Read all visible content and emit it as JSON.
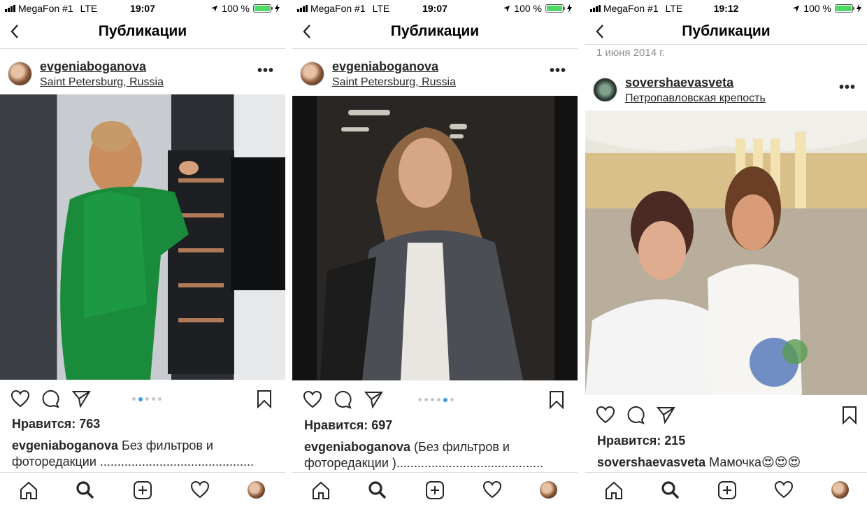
{
  "screens": [
    {
      "status": {
        "carrier": "MegaFon #1",
        "network": "LTE",
        "time": "19:07",
        "battery": "100 %"
      },
      "nav_title": "Публикации",
      "date_header": "",
      "post": {
        "username": "evgeniaboganova",
        "location": "Saint Petersburg, Russia",
        "likes": "Нравится: 763",
        "caption_user": "evgeniaboganova",
        "caption_text": " Без фильтров и фоторедакции ............................................",
        "carousel_active": 1,
        "carousel_count": 5
      }
    },
    {
      "status": {
        "carrier": "MegaFon #1",
        "network": "LTE",
        "time": "19:07",
        "battery": "100 %"
      },
      "nav_title": "Публикации",
      "date_header": "",
      "post": {
        "username": "evgeniaboganova",
        "location": "Saint Petersburg, Russia",
        "likes": "Нравится: 697",
        "caption_user": "evgeniaboganova",
        "caption_text": " (Без фильтров и фоторедакции )..........................................",
        "carousel_active": 4,
        "carousel_count": 6
      }
    },
    {
      "status": {
        "carrier": "MegaFon #1",
        "network": "LTE",
        "time": "19:12",
        "battery": "100 %"
      },
      "nav_title": "Публикации",
      "date_header": "1 июня 2014 г.",
      "post": {
        "username": "sovershaevasveta",
        "location": "Петропавловская крепость",
        "likes": "Нравится: 215",
        "caption_user": "sovershaevasveta",
        "caption_text": " Мамочка😍😍😍",
        "carousel_active": null,
        "carousel_count": 0
      }
    }
  ],
  "icons": {
    "back": "chevron-left-icon",
    "more": "more-dots-icon",
    "like": "heart-icon",
    "comment": "comment-icon",
    "share": "send-icon",
    "save": "bookmark-icon",
    "home": "home-icon",
    "search": "search-icon",
    "new_post": "add-post-icon",
    "activity": "heart-icon"
  },
  "colors": {
    "accent": "#3897f0",
    "text": "#262626",
    "muted": "#8e8e8e",
    "battery": "#4cd964"
  }
}
